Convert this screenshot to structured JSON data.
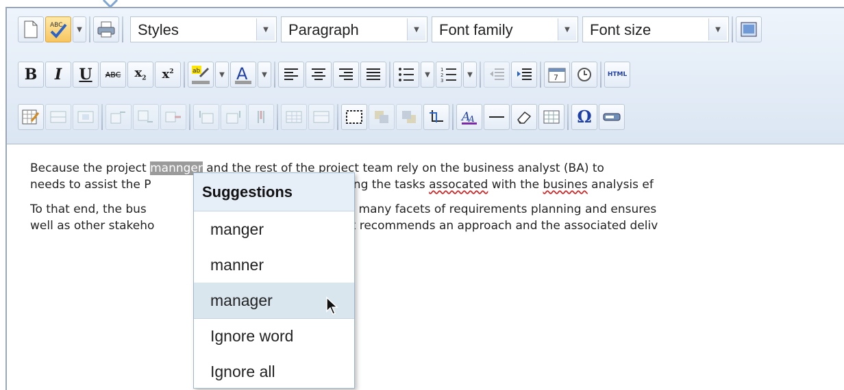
{
  "toolbar": {
    "styles_label": "Styles",
    "format_label": "Paragraph",
    "font_family_label": "Font family",
    "font_size_label": "Font size",
    "bold_label": "B",
    "italic_label": "I",
    "underline_label": "U",
    "strike_label": "ABC",
    "html_label": "HTML"
  },
  "document": {
    "p1": {
      "pre": "Because the project ",
      "misspelled": "mannger",
      "line1_rest": " and the rest of the project team rely on the business analyst (BA) to",
      "line2_a": "needs to assist the P",
      "line2_b": "monitoring the tasks ",
      "err1": "assocated",
      "line2_c": " with the ",
      "err2": "busines",
      "line2_d": " analysis ef"
    },
    "p2": {
      "line1_a": "To that end, the bus",
      "line1_b": "lers the many facets of requirements planning and ensures",
      "line2_a": "well as other stakeho",
      "line2_b": "analyst recommends an approach and the associated deliv"
    }
  },
  "suggestions": {
    "header": "Suggestions",
    "items": [
      "manger",
      "manner",
      "manager"
    ],
    "ignore_word": "Ignore word",
    "ignore_all": "Ignore all",
    "hovered_index": 2
  }
}
